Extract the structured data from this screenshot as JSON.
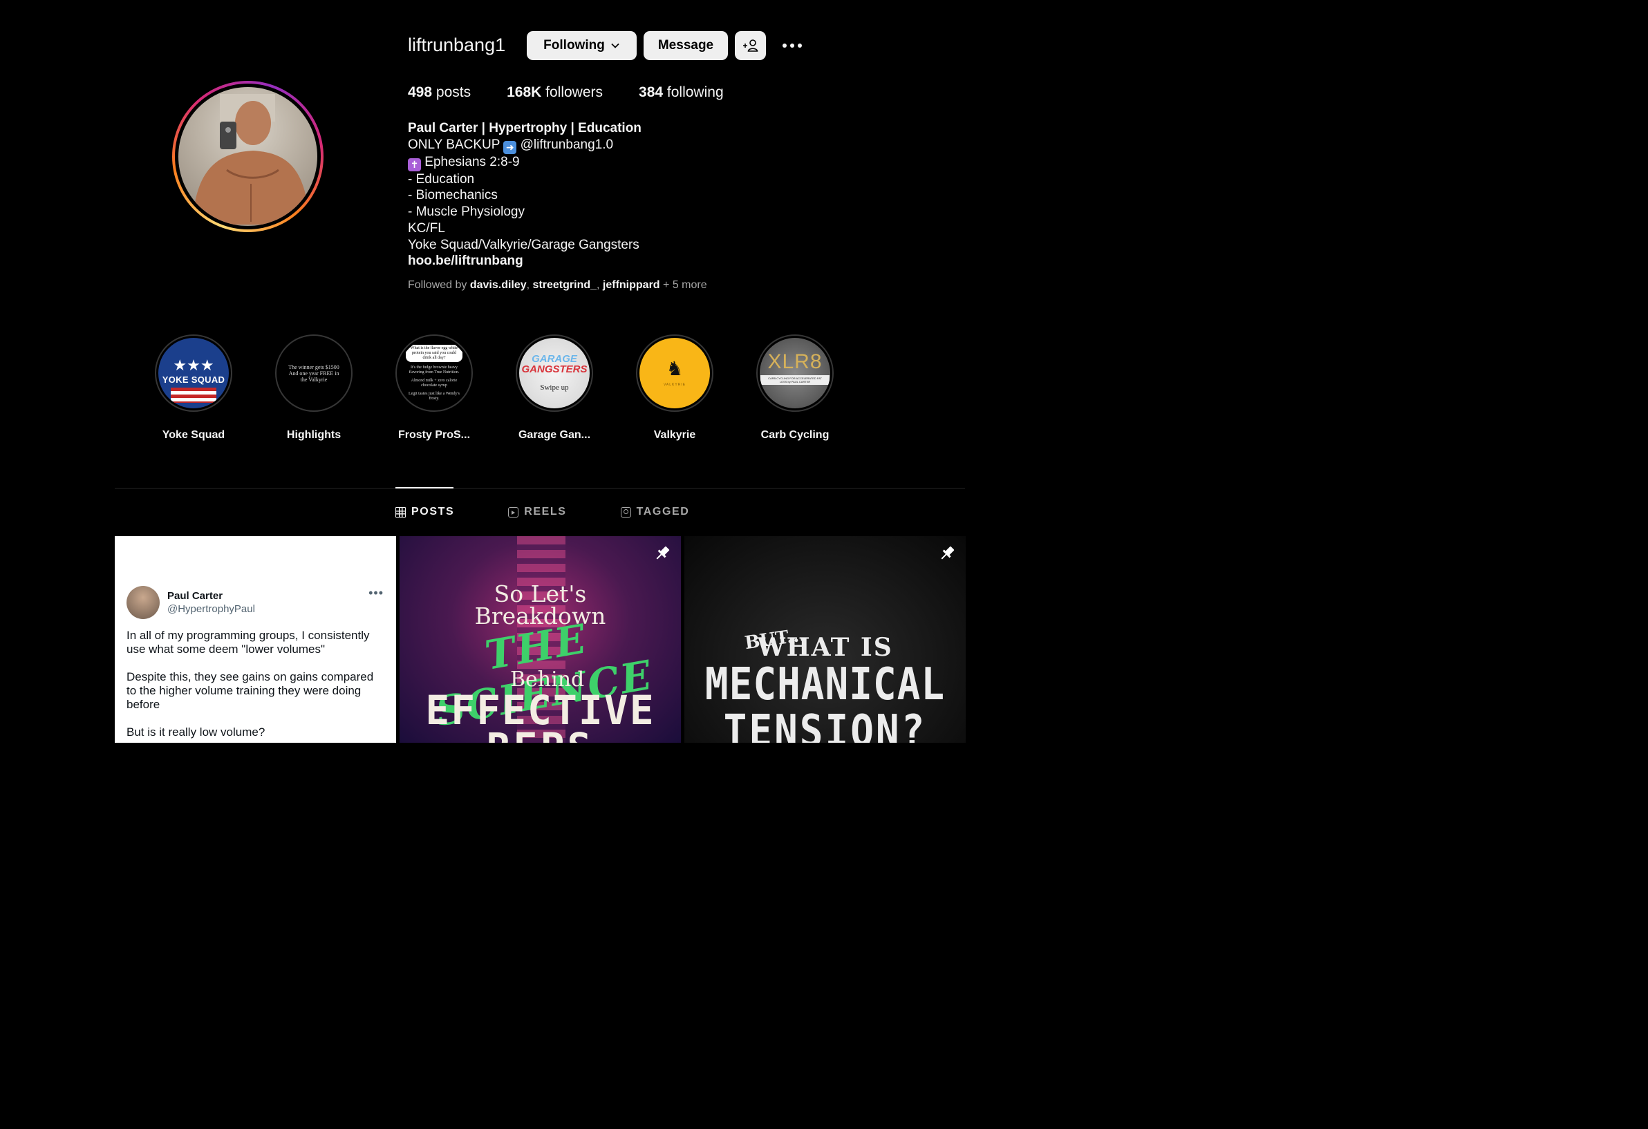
{
  "profile": {
    "username": "liftrunbang1",
    "following_label": "Following",
    "message_label": "Message",
    "stats": {
      "posts_count": "498",
      "posts_label": "posts",
      "followers_count": "168K",
      "followers_label": "followers",
      "following_count": "384",
      "following_label": "following"
    },
    "bio": {
      "name": "Paul Carter | Hypertrophy | Education",
      "line1_prefix": "ONLY BACKUP",
      "line1_suffix": "@liftrunbang1.0",
      "line2": "Ephesians 2:8-9",
      "line3": "- Education",
      "line4": "- Biomechanics",
      "line5": "- Muscle Physiology",
      "line6": "KC/FL",
      "line7": "Yoke Squad/Valkyrie/Garage Gangsters",
      "link": "hoo.be/liftrunbang"
    },
    "followed_by": {
      "prefix": "Followed by",
      "user1": "davis.diley",
      "user2": "streetgrind_",
      "user3": "jeffnippard",
      "more": "+ 5 more"
    }
  },
  "highlights": [
    {
      "label": "Yoke Squad",
      "cover_text": "YOKE SQUAD"
    },
    {
      "label": "Highlights",
      "cover_text": "The winner gets $1500 And one year FREE in the Valkyrie"
    },
    {
      "label": "Frosty ProS...",
      "cover_text_1": "What is the flavor egg white protein you said you could drink all day?",
      "cover_text_2": "It's the fudge brownie heavy flavoring from True Nutrition.",
      "cover_text_3": "Almond milk + zero calorie chocolate syrup",
      "cover_text_4": "Legit tastes just like a Wendy's frosty."
    },
    {
      "label": "Garage Gan...",
      "cover_text_1": "GARAGE",
      "cover_text_2": "GANGSTERS",
      "cover_text_3": "Swipe up"
    },
    {
      "label": "Valkyrie",
      "cover_text": "VALKYRIE"
    },
    {
      "label": "Carb Cycling",
      "cover_text_1": "XLR8",
      "cover_text_2": "CARB CYCLING FOR ACCELERATED FAT LOSS by PAUL CARTER"
    }
  ],
  "tabs": {
    "posts": "POSTS",
    "reels": "REELS",
    "tagged": "TAGGED",
    "active": "posts"
  },
  "posts": {
    "tweet": {
      "name": "Paul Carter",
      "handle": "@HypertrophyPaul",
      "more": "•••",
      "para1": "In all of my programming groups, I consistently use what some deem \"lower volumes\"",
      "para2": "Despite this, they see gains on gains compared to the higher volume training they were doing before",
      "para3": "But is it really low volume?"
    },
    "science": {
      "line1": "So Let's",
      "line2": "Breakdown",
      "line3": "THE SCIENCE",
      "line4": "Behind",
      "line5": "EFFECTIVE",
      "line6": "REPS"
    },
    "tension": {
      "line1": "BUT...",
      "line2": "WHAT IS",
      "line3": "MECHANICAL",
      "line4": "TENSION?"
    }
  },
  "colors": {
    "background": "#000000",
    "button_bg": "#efefef",
    "muted_text": "#a8a8a8",
    "story_ring_start": "#feda75",
    "story_ring_end": "#962fbf"
  }
}
